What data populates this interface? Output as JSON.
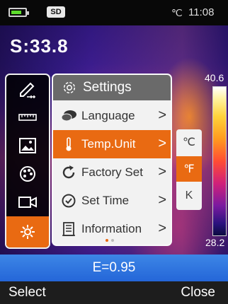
{
  "status": {
    "sd_label": "SD",
    "temp_unit": "℃",
    "time": "11:08"
  },
  "spot_reading": "S:33.8",
  "scale": {
    "max": "40.6",
    "min": "28.2"
  },
  "sidebar": {
    "items": [
      {
        "icon": "pen-icon"
      },
      {
        "icon": "ruler-icon"
      },
      {
        "icon": "image-icon"
      },
      {
        "icon": "palette-icon"
      },
      {
        "icon": "video-camera-icon"
      },
      {
        "icon": "gear-icon",
        "active": true
      }
    ]
  },
  "settings": {
    "title": "Settings",
    "items": [
      {
        "label": "Language",
        "icon": "chat-bubbles-icon"
      },
      {
        "label": "Temp.Unit",
        "icon": "thermometer-icon",
        "active": true
      },
      {
        "label": "Factory Set",
        "icon": "reset-icon"
      },
      {
        "label": "Set Time",
        "icon": "clock-icon"
      },
      {
        "label": "Information",
        "icon": "info-list-icon"
      }
    ],
    "chevron": ">"
  },
  "units": {
    "celsius": "℃",
    "fahrenheit": "℉",
    "kelvin": "K",
    "selected": "fahrenheit"
  },
  "emissivity": "E=0.95",
  "softkeys": {
    "left": "Select",
    "right": "Close"
  },
  "colors": {
    "accent": "#e96a12",
    "bar_blue": "#2466d8"
  }
}
